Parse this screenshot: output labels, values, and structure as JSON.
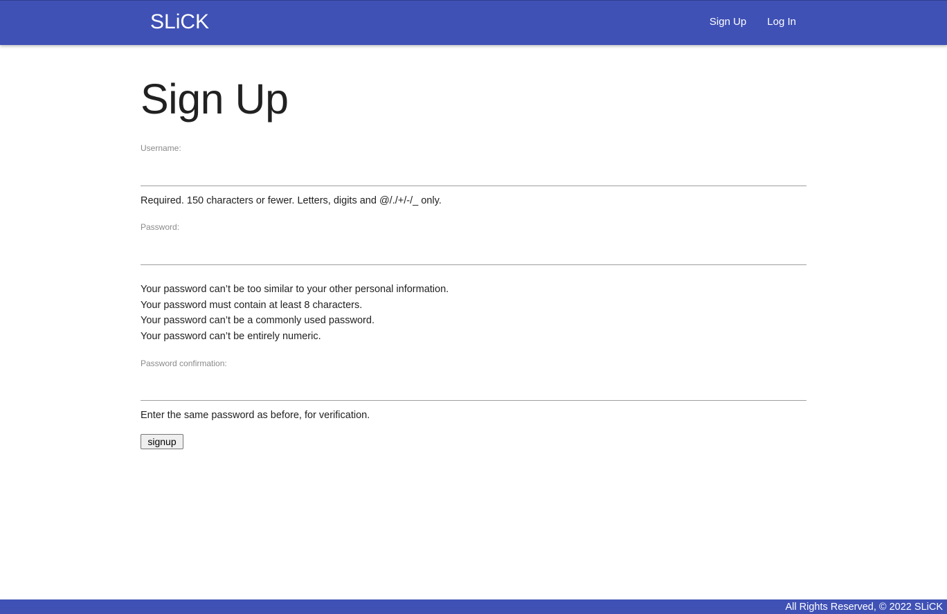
{
  "navbar": {
    "brand": "SLiCK",
    "links": [
      {
        "label": "Sign Up"
      },
      {
        "label": "Log In"
      }
    ]
  },
  "main": {
    "title": "Sign Up",
    "username": {
      "label": "Username:",
      "value": "",
      "help": "Required. 150 characters or fewer. Letters, digits and @/./+/-/_ only."
    },
    "password": {
      "label": "Password:",
      "value": "",
      "help": [
        "Your password can’t be too similar to your other personal information.",
        "Your password must contain at least 8 characters.",
        "Your password can’t be a commonly used password.",
        "Your password can’t be entirely numeric."
      ]
    },
    "password_confirmation": {
      "label": "Password confirmation:",
      "value": "",
      "help": "Enter the same password as before, for verification."
    },
    "submit_label": "signup"
  },
  "footer": {
    "text": "All Rights Reserved, © 2022 SLiCK"
  },
  "colors": {
    "brand": "#3f51b5",
    "text": "#212121",
    "label": "#8a8a8a"
  }
}
